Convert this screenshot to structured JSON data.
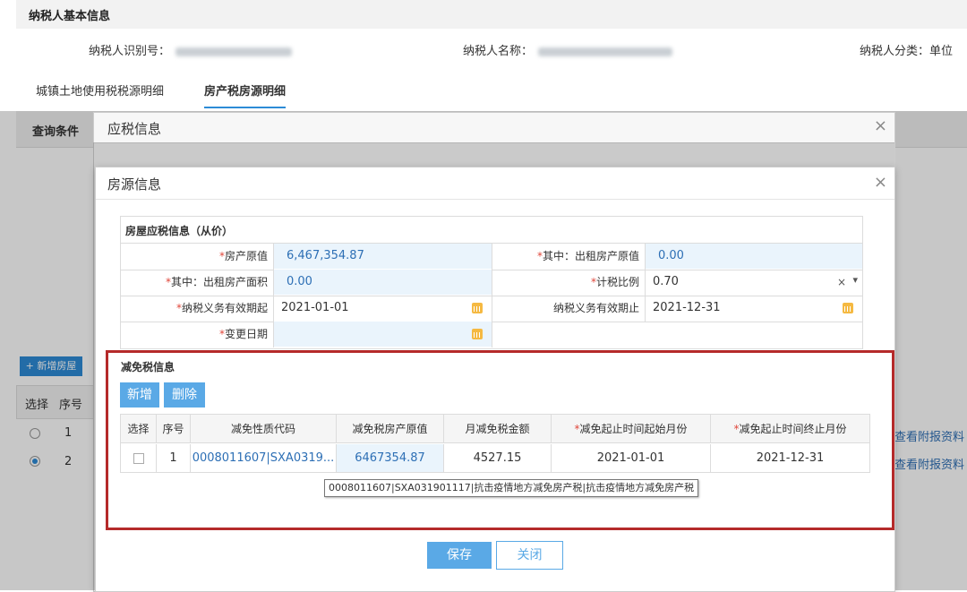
{
  "header": {
    "title": "纳税人基本信息",
    "taxpayer_id_label": "纳税人识别号：",
    "taxpayer_name_label": "纳税人名称：",
    "taxpayer_category_label": "纳税人分类：",
    "taxpayer_category_value": "单位"
  },
  "tabs": [
    {
      "label": "城镇土地使用税税源明细"
    },
    {
      "label": "房产税房源明细"
    }
  ],
  "background": {
    "query_label": "查询条件",
    "add_house_label": "+ 新增房屋",
    "col_select": "选择",
    "col_seq": "序号",
    "rows": [
      {
        "seq": "1",
        "link": "查看附报资料"
      },
      {
        "seq": "2",
        "link": "查看附报资料"
      }
    ]
  },
  "modal_tax": {
    "title": "应税信息",
    "close": "×"
  },
  "modal_house": {
    "title": "房源信息",
    "close": "×",
    "section_title": "房屋应税信息（从价）",
    "fields": {
      "original_value_label": "房产原值",
      "original_value": "6,467,354.87",
      "rented_value_label": "其中：出租房产原值",
      "rented_value": "0.00",
      "rented_area_label": "其中：出租房产面积",
      "rented_area": "0.00",
      "tax_ratio_label": "计税比例",
      "tax_ratio": "0.70",
      "tax_ratio_clear": "×",
      "tax_ratio_arrow": "▾",
      "start_label": "纳税义务有效期起",
      "start_value": "2021-01-01",
      "end_label": "纳税义务有效期止",
      "end_value": "2021-12-31",
      "change_label": "变更日期",
      "change_value": ""
    },
    "required_mark": "*",
    "exemption": {
      "title": "减免税信息",
      "add_label": "新增",
      "delete_label": "删除",
      "columns": [
        "选择",
        "序号",
        "减免性质代码",
        "减免税房产原值",
        "月减免税金额",
        "减免起止时间起始月份",
        "减免起止时间终止月份"
      ],
      "rows": [
        {
          "seq": "1",
          "code": "0008011607|SXA0319...",
          "value": "6467354.87",
          "monthly": "4527.15",
          "start": "2021-01-01",
          "end": "2021-12-31"
        }
      ],
      "tooltip": "0008011607|SXA031901117|抗击疫情地方减免房产税|抗击疫情地方减免房产税"
    },
    "save_label": "保存",
    "close_label": "关闭"
  },
  "colors": {
    "accent": "#2d8bd6",
    "button": "#5aa9e6",
    "highlight_border": "#b52a2a",
    "required": "#e0463a"
  }
}
